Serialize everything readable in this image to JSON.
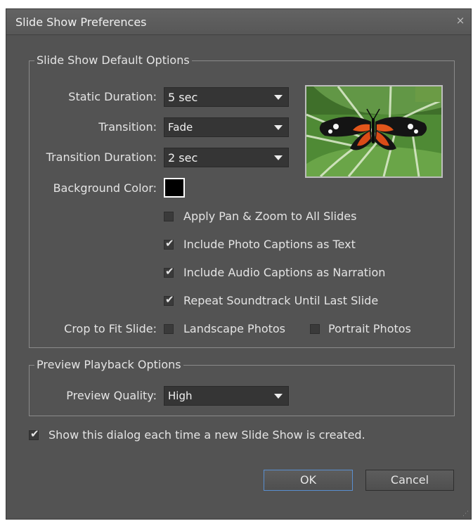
{
  "window": {
    "title": "Slide Show Preferences",
    "close_symbol": "×"
  },
  "default_options": {
    "legend": "Slide Show Default Options",
    "static_duration": {
      "label": "Static Duration:",
      "value": "5 sec"
    },
    "transition": {
      "label": "Transition:",
      "value": "Fade"
    },
    "transition_duration": {
      "label": "Transition Duration:",
      "value": "2 sec"
    },
    "background_color": {
      "label": "Background Color:",
      "value": "#000000"
    },
    "checkboxes": [
      {
        "label": "Apply Pan & Zoom to All Slides",
        "checked": false
      },
      {
        "label": "Include Photo Captions as Text",
        "checked": true
      },
      {
        "label": "Include Audio Captions as Narration",
        "checked": true
      },
      {
        "label": "Repeat Soundtrack Until Last Slide",
        "checked": true
      }
    ],
    "crop_to_fit": {
      "label": "Crop to Fit Slide:",
      "landscape": {
        "label": "Landscape Photos",
        "checked": false
      },
      "portrait": {
        "label": "Portrait Photos",
        "checked": false
      }
    },
    "preview_image": "butterfly-photo"
  },
  "preview_playback": {
    "legend": "Preview Playback Options",
    "quality": {
      "label": "Preview Quality:",
      "value": "High"
    }
  },
  "show_dialog": {
    "label": "Show this dialog each time a new Slide Show is created.",
    "checked": true
  },
  "buttons": {
    "ok": "OK",
    "cancel": "Cancel"
  },
  "colors": {
    "dialog_bg": "#535353",
    "field_bg": "#353535",
    "ok_border": "#5a8fd0"
  }
}
